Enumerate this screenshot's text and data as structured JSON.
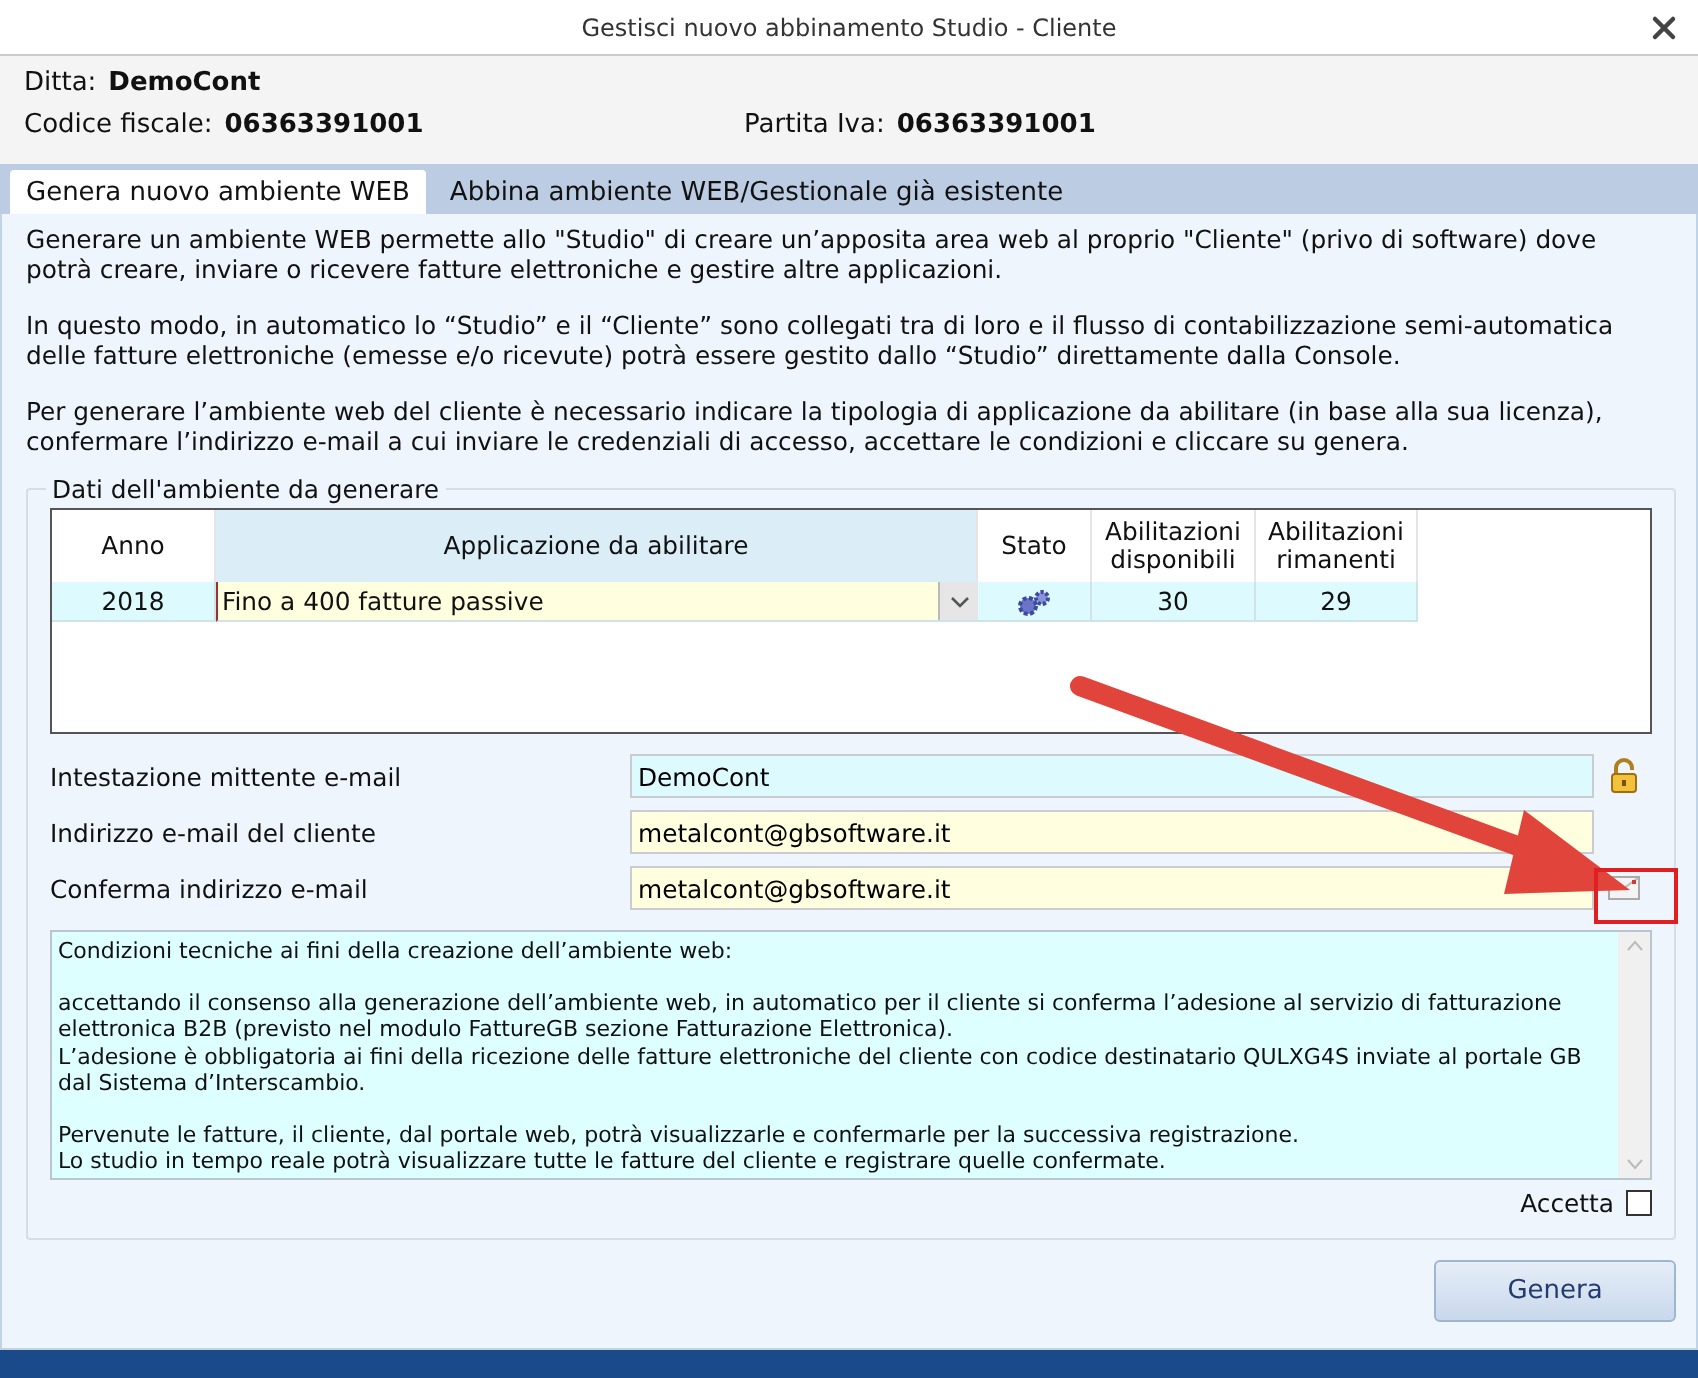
{
  "window": {
    "title": "Gestisci nuovo abbinamento Studio - Cliente"
  },
  "header": {
    "ditta_label": "Ditta:",
    "ditta": "DemoCont",
    "codice_fiscale_label": "Codice fiscale:",
    "codice_fiscale": "06363391001",
    "partita_iva_label": "Partita Iva:",
    "partita_iva": "06363391001"
  },
  "tabs": [
    {
      "label": "Genera nuovo ambiente WEB",
      "selected": true
    },
    {
      "label": "Abbina ambiente WEB/Gestionale già esistente",
      "selected": false
    }
  ],
  "intro": [
    "Generare un ambiente WEB permette allo \"Studio\" di creare un’apposita area web al proprio \"Cliente\" (privo di software) dove potrà creare, inviare o ricevere fatture elettroniche e gestire altre applicazioni.",
    "In questo modo, in automatico lo “Studio” e il “Cliente” sono collegati tra di loro e il flusso di contabilizzazione semi-automatica delle fatture elettroniche (emesse e/o ricevute) potrà essere gestito dallo “Studio” direttamente dalla Console.",
    "Per generare l’ambiente web del cliente è necessario indicare la tipologia di applicazione da abilitare (in base alla sua licenza), confermare l’indirizzo e-mail a cui inviare le credenziali di accesso, accettare le condizioni e cliccare su genera."
  ],
  "group": {
    "title": "Dati dell'ambiente da generare",
    "table": {
      "columns": [
        "Anno",
        "Applicazione da abilitare",
        "Stato",
        "Abilitazioni disponibili",
        "Abilitazioni rimanenti"
      ],
      "rows": [
        {
          "anno": "2018",
          "applicazione": "Fino a 400 fatture passive",
          "disponibili": "30",
          "rimanenti": "29"
        }
      ]
    },
    "fields": [
      {
        "label": "Intestazione mittente e-mail",
        "value": "DemoCont",
        "kind": "locked"
      },
      {
        "label": "Indirizzo e-mail del cliente",
        "value": "metalcont@gbsoftware.it",
        "kind": "plain"
      },
      {
        "label": "Conferma indirizzo e-mail",
        "value": "metalcont@gbsoftware.it",
        "kind": "confirm"
      }
    ],
    "conditions": [
      "Condizioni tecniche ai fini della creazione dell’ambiente web:",
      "accettando il consenso alla generazione dell’ambiente web, in automatico per il cliente si conferma l’adesione al servizio di fatturazione elettronica B2B (previsto nel modulo FattureGB sezione Fatturazione Elettronica).\nL’adesione è obbligatoria ai fini della ricezione delle fatture elettroniche del cliente con codice destinatario QULXG4S inviate al portale GB dal Sistema d’Interscambio.",
      "Pervenute le fatture, il cliente, dal portale web, potrà visualizzarle e confermarle per la successiva registrazione.\nLo studio in tempo reale potrà visualizzare tutte le fatture del cliente e registrare quelle confermate."
    ],
    "accept": {
      "label": "Accetta",
      "checked": false
    }
  },
  "button": "Genera"
}
